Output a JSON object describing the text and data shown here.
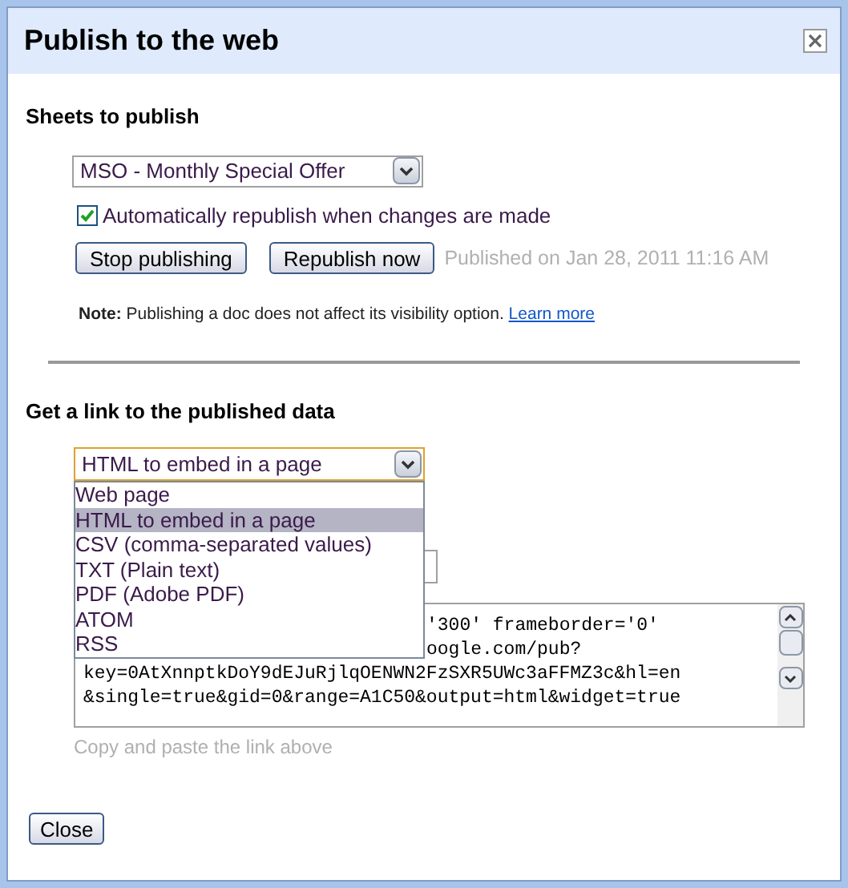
{
  "dialog": {
    "title": "Publish to the web"
  },
  "sheets": {
    "heading": "Sheets to publish",
    "select_value": "MSO - Monthly Special Offer",
    "auto_republish": {
      "label": "Automatically republish when changes are made",
      "checked": true
    },
    "buttons": [
      "Stop publishing",
      "Republish now"
    ],
    "status": "Published on Jan 28, 2011 11:16 AM",
    "note": {
      "label": "Note:",
      "text": "Publishing a doc does not affect its visibility option.",
      "link": "Learn more"
    }
  },
  "link": {
    "heading": "Get a link to the published data",
    "format_select": {
      "value": "HTML to embed in a page",
      "expanded": true,
      "options": [
        {
          "label": "Web page",
          "selected": false
        },
        {
          "label": "HTML to embed in a page",
          "selected": true
        },
        {
          "label": "CSV (comma-separated values)",
          "selected": false
        },
        {
          "label": "TXT (Plain text)",
          "selected": false
        },
        {
          "label": "PDF (Adobe PDF)",
          "selected": false
        },
        {
          "label": "ATOM",
          "selected": false
        },
        {
          "label": "RSS",
          "selected": false
        }
      ]
    },
    "code": {
      "line_tails": [
        "'300' frameborder='0'",
        "oogle.com/pub?"
      ],
      "lines": [
        "key=0AtXnnptkDoY9dEJuRjlqOENWN2FzSXR5UWc3aFFMZ3c&hl=en",
        "&single=true&gid=0&range=A1C50&output=html&widget=true"
      ]
    },
    "hint": "Copy and paste the link above"
  },
  "close_button": "Close"
}
